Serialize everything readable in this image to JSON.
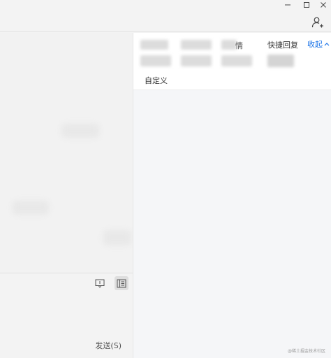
{
  "window": {
    "minimize_label": "—",
    "maximize_label": "□",
    "close_label": "✕"
  },
  "input": {
    "send_label": "发送(S)"
  },
  "side_panel": {
    "tabs": {
      "emoji_partial": "情",
      "quick_reply": "快捷回复",
      "custom": "自定义"
    },
    "collapse_label": "收起",
    "watermark": "@稀土掘金技术社区"
  },
  "colors": {
    "accent": "#1a73e8",
    "background": "#f3f3f3",
    "panel": "#ffffff"
  }
}
